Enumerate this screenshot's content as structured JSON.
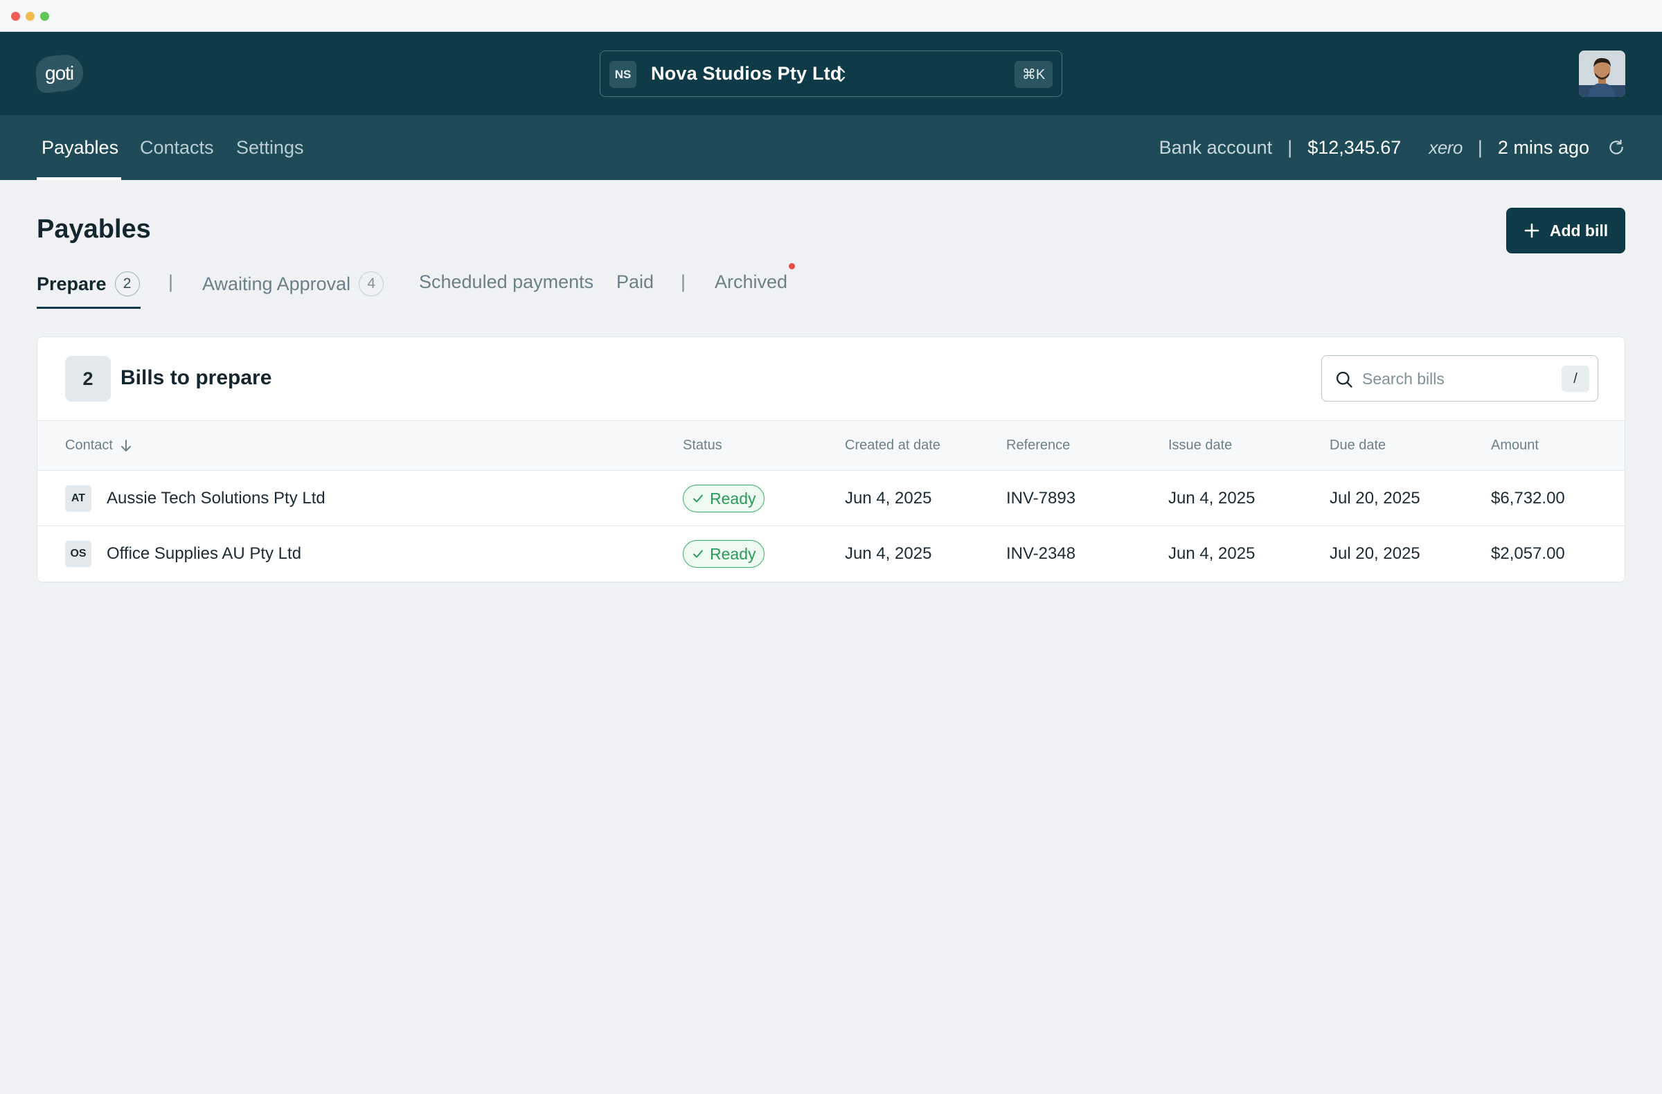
{
  "app": {
    "logo_text": "goti",
    "org": {
      "initials": "NS",
      "name": "Nova Studios Pty Ltd",
      "shortcut": "⌘K"
    }
  },
  "nav": {
    "tabs": [
      {
        "label": "Payables",
        "active": true
      },
      {
        "label": "Contacts",
        "active": false
      },
      {
        "label": "Settings",
        "active": false
      }
    ]
  },
  "sync": {
    "bank_label": "Bank account",
    "separator": "|",
    "balance": "$12,345.67",
    "provider": "xero",
    "updated": "2 mins ago"
  },
  "page": {
    "title": "Payables",
    "add_button": "Add bill"
  },
  "status_tabs": [
    {
      "label": "Prepare",
      "count": "2",
      "active": true
    },
    {
      "label": "Awaiting Approval",
      "count": "4",
      "active": false
    },
    {
      "label": "Scheduled payments",
      "active": false
    },
    {
      "label": "Paid",
      "active": false
    },
    {
      "label": "Archived",
      "active": false,
      "has_notification": true
    }
  ],
  "panel": {
    "count": "2",
    "title": "Bills to prepare",
    "search_placeholder": "Search bills",
    "search_shortcut": "/"
  },
  "table": {
    "columns": [
      "Contact",
      "Status",
      "Created at date",
      "Reference",
      "Issue date",
      "Due date",
      "Amount"
    ],
    "rows": [
      {
        "initials": "AT",
        "contact": "Aussie Tech Solutions Pty Ltd",
        "status": "Ready",
        "created": "Jun 4, 2025",
        "reference": "INV-7893",
        "issue": "Jun 4, 2025",
        "due": "Jul 20, 2025",
        "amount": "$6,732.00"
      },
      {
        "initials": "OS",
        "contact": "Office Supplies AU Pty Ltd",
        "status": "Ready",
        "created": "Jun 4, 2025",
        "reference": "INV-2348",
        "issue": "Jun 4, 2025",
        "due": "Jul 20, 2025",
        "amount": "$2,057.00"
      }
    ]
  },
  "colors": {
    "brand_dark": "#0e3b47",
    "subnav": "#1f4b58",
    "status_ready": "#2a9a58",
    "notification": "#ea4a4a",
    "background": "#eff1f4"
  }
}
